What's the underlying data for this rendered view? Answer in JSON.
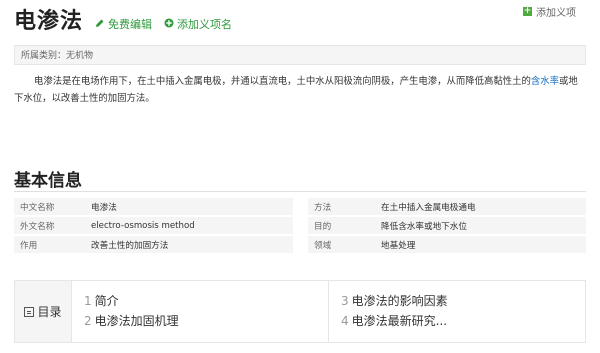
{
  "page": {
    "title": "电渗法",
    "edit_label": "免费编辑",
    "add_term_label": "添加义项名",
    "add_top_label": "添加义项"
  },
  "category": "所属类别：无机物",
  "intro": {
    "text_before_link": "电渗法是在电场作用下，在土中插入金属电极，并通以直流电，土中水从阳极流向阴极，产生电渗，从而降低高黏性土的",
    "link_text": "含水率",
    "text_after_link": "或地下水位，以改善土性的加固方法。"
  },
  "basic_info": {
    "heading": "基本信息",
    "rows": [
      {
        "k1": "中文名称",
        "v1": "电渗法",
        "k2": "方法",
        "v2": "在土中插入金属电极通电"
      },
      {
        "k1": "外文名称",
        "v1": "electro-osmosis method",
        "k2": "目的",
        "v2": "降低含水率或地下水位"
      },
      {
        "k1": "作用",
        "v1": "改善土性的加固方法",
        "k2": "领域",
        "v2": "地基处理"
      }
    ]
  },
  "toc": {
    "label": "目录",
    "items": [
      {
        "num": "1",
        "text": "简介"
      },
      {
        "num": "2",
        "text": "电渗法加固机理"
      },
      {
        "num": "3",
        "text": "电渗法的影响因素"
      },
      {
        "num": "4",
        "text": "电渗法最新研究..."
      }
    ]
  },
  "colors": {
    "link": "#136ec2",
    "green": "#2e9a3c"
  }
}
